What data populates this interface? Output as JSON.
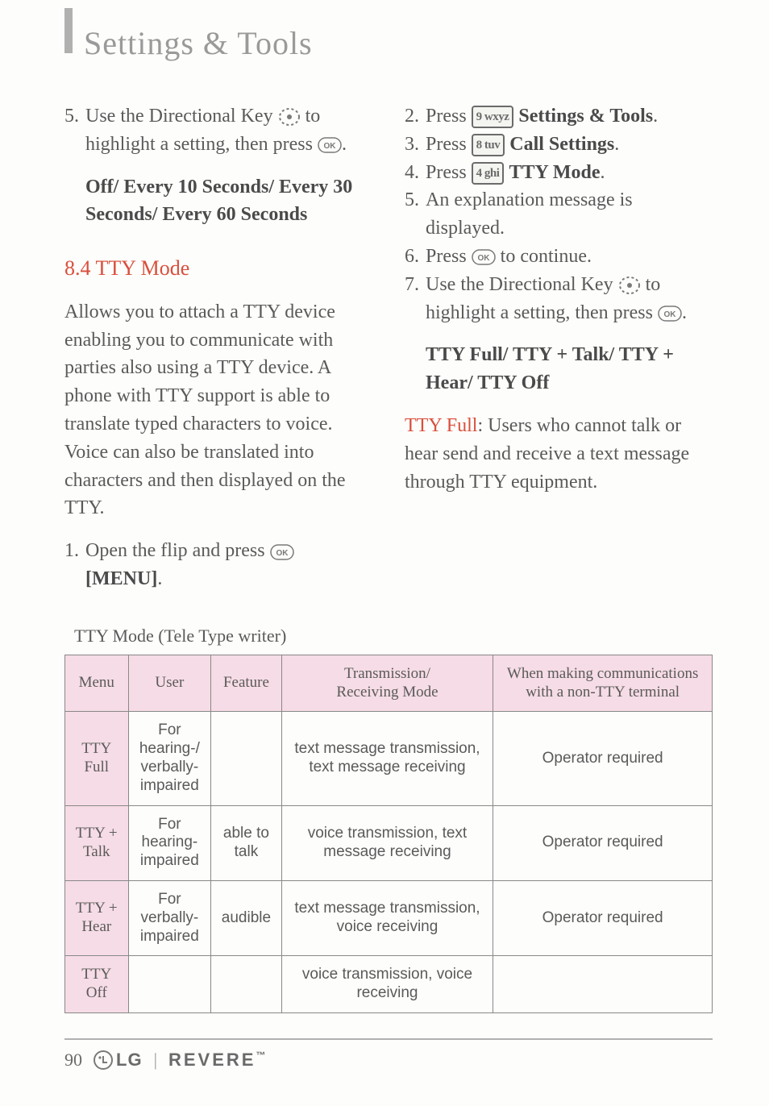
{
  "page_title": "Settings & Tools",
  "left": {
    "step5a": "5.",
    "step5b": "Use the Directional Key",
    "step5c": "to highlight a setting, then press",
    "step5d": ".",
    "options_line": "Off/ Every 10 Seconds/ Every 30 Seconds/ Every 60 Seconds",
    "section_heading": "8.4 TTY Mode",
    "tty_intro": "Allows you to attach a TTY device enabling you to communicate with parties also using a TTY device. A phone with TTY support is able to translate typed characters to voice. Voice can also be translated into characters and then displayed on the TTY.",
    "step1a": "1.",
    "step1b": "Open the flip and press",
    "step1c": "[MENU]",
    "step1d": "."
  },
  "right": {
    "s2a": "2.",
    "s2b": "Press",
    "s2c": "Settings & Tools",
    "s2d": ".",
    "s3a": "3.",
    "s3b": "Press",
    "s3c": "Call Settings",
    "s3d": ".",
    "s4a": "4.",
    "s4b": "Press",
    "s4c": "TTY Mode",
    "s4d": ".",
    "s5a": "5.",
    "s5b": "An explanation message is displayed.",
    "s6a": "6.",
    "s6b": "Press",
    "s6c": "to continue.",
    "s7a": "7.",
    "s7b": "Use the Directional Key",
    "s7c": "to highlight a setting, then press",
    "s7d": ".",
    "opts": "TTY Full/ TTY + Talk/ TTY + Hear/ TTY Off",
    "ttyfull_label": "TTY Full",
    "ttyfull_text": ": Users who cannot  talk or hear send and receive a text message through TTY equipment."
  },
  "keys": {
    "nine": "9 wxyz",
    "eight": "8 tuv",
    "four": "4 ghi",
    "ok": "OK"
  },
  "table": {
    "caption": "TTY Mode (Tele Type writer)",
    "headers": [
      "Menu",
      "User",
      "Feature",
      "Transmission/\nReceiving Mode",
      "When making communications with a non-TTY terminal"
    ],
    "rows": [
      {
        "menu": "TTY Full",
        "user": "For hearing-/\nverbally-\nimpaired",
        "feature": "",
        "mode": "text message transmission, text message receiving",
        "op": "Operator required"
      },
      {
        "menu": "TTY + Talk",
        "user": "For hearing-\nimpaired",
        "feature": "able to talk",
        "mode": "voice transmission, text message receiving",
        "op": "Operator required"
      },
      {
        "menu": "TTY + Hear",
        "user": "For verbally-\nimpaired",
        "feature": "audible",
        "mode": "text message transmission, voice receiving",
        "op": "Operator required"
      },
      {
        "menu": "TTY Off",
        "user": "",
        "feature": "",
        "mode": "voice transmission, voice receiving",
        "op": ""
      }
    ]
  },
  "footer": {
    "page_number": "90",
    "brand1": "LG",
    "brand2": "REVERE",
    "tm": "™"
  },
  "chart_data": {
    "type": "table",
    "title": "TTY Mode (Tele Type writer)",
    "columns": [
      "Menu",
      "User",
      "Feature",
      "Transmission/Receiving Mode",
      "When making communications with a non-TTY terminal"
    ],
    "rows": [
      [
        "TTY Full",
        "For hearing-/verbally-impaired",
        "",
        "text message transmission, text message receiving",
        "Operator required"
      ],
      [
        "TTY + Talk",
        "For hearing-impaired",
        "able to talk",
        "voice transmission, text message receiving",
        "Operator required"
      ],
      [
        "TTY + Hear",
        "For verbally-impaired",
        "audible",
        "text message transmission, voice receiving",
        "Operator required"
      ],
      [
        "TTY Off",
        "",
        "",
        "voice transmission, voice receiving",
        ""
      ]
    ]
  }
}
